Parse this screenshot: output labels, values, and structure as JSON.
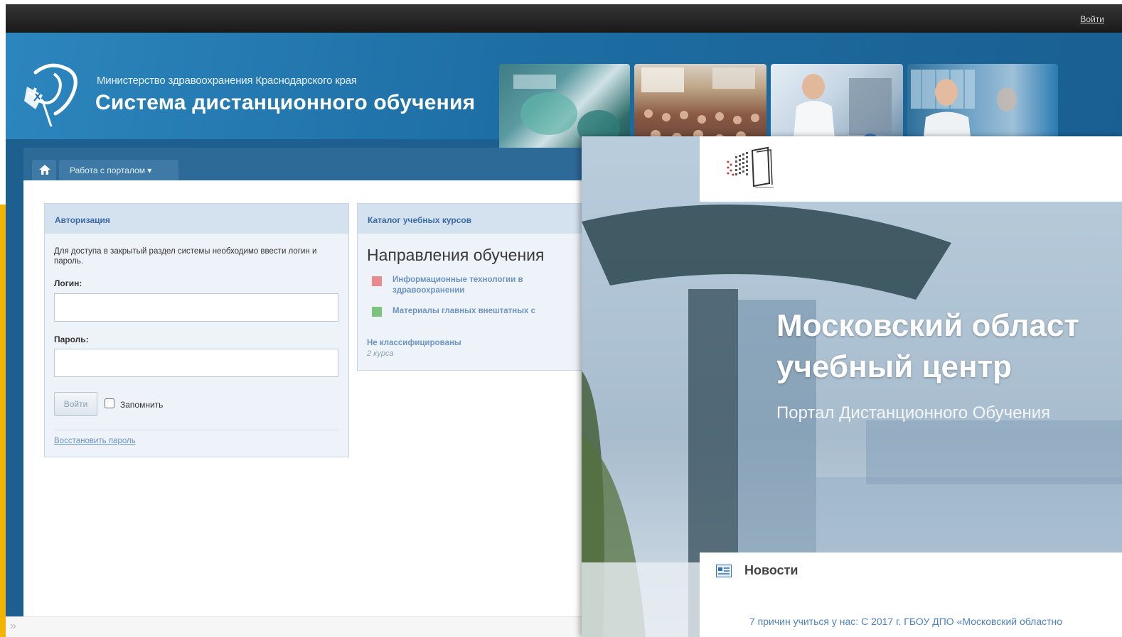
{
  "topbar": {
    "login_link": "Войти"
  },
  "header": {
    "ministry": "Министерство здравоохранения Краснодарского края",
    "system_title": "Система дистанционного обучения"
  },
  "nav": {
    "portal_menu": "Работа с порталом ▾"
  },
  "auth": {
    "title": "Авторизация",
    "description": "Для доступа в закрытый раздел системы необходимо ввести логин и пароль.",
    "login_label": "Логин:",
    "login_value": "",
    "password_label": "Пароль:",
    "password_value": "",
    "submit_label": "Войти",
    "remember_label": "Запомнить",
    "remember_checked": false,
    "restore_link": "Восстановить пароль"
  },
  "catalog": {
    "title": "Каталог учебных курсов",
    "heading": "Направления обучения",
    "directions": [
      {
        "label": "Информационные технологии в здравоохранении",
        "color": "#e98a8f"
      },
      {
        "label": "Материалы главных внештатных с",
        "color": "#7cc47e"
      }
    ],
    "unclassified_label": "Не классифицированы",
    "unclassified_count": "2 курса"
  },
  "overlay": {
    "title": "Московский област\nучебный центр",
    "subtitle": "Портал Дистанционного Обучения",
    "news_title": "Новости",
    "news_item": "7 причин учиться у нас: С 2017 г. ГБОУ ДПО «Московский областно"
  },
  "colors": {
    "brand_blue": "#1d5f8e",
    "header_blue": "#2c86bd",
    "link_blue": "#3a6aa6",
    "accent_yellow": "#f2b400"
  }
}
